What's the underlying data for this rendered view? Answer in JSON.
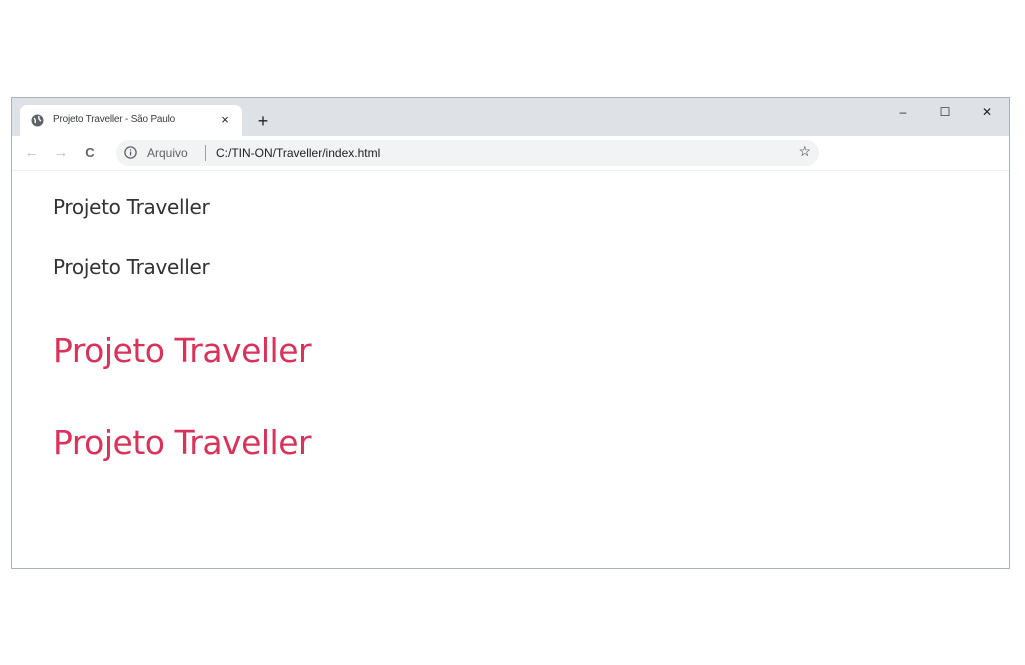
{
  "browser": {
    "tab_title": "Projeto Traveller - São Paulo",
    "tab_close_icon": "×",
    "new_tab_icon": "+",
    "minimize_icon": "–",
    "maximize_icon": "☐",
    "close_window_icon": "✕",
    "back_icon": "←",
    "forward_icon": "→",
    "reload_icon": "C",
    "security_label": "Arquivo",
    "url": "C:/TIN-ON/Traveller/index.html",
    "bookmark_icon": "☆"
  },
  "page": {
    "headings": [
      {
        "text": "Projeto Traveller",
        "style": "small",
        "color": "#333333"
      },
      {
        "text": "Projeto Traveller",
        "style": "small",
        "color": "#333333"
      },
      {
        "text": "Projeto Traveller",
        "style": "large",
        "color": "#d8335a"
      },
      {
        "text": "Projeto Traveller",
        "style": "large",
        "color": "#d8335a"
      }
    ]
  }
}
